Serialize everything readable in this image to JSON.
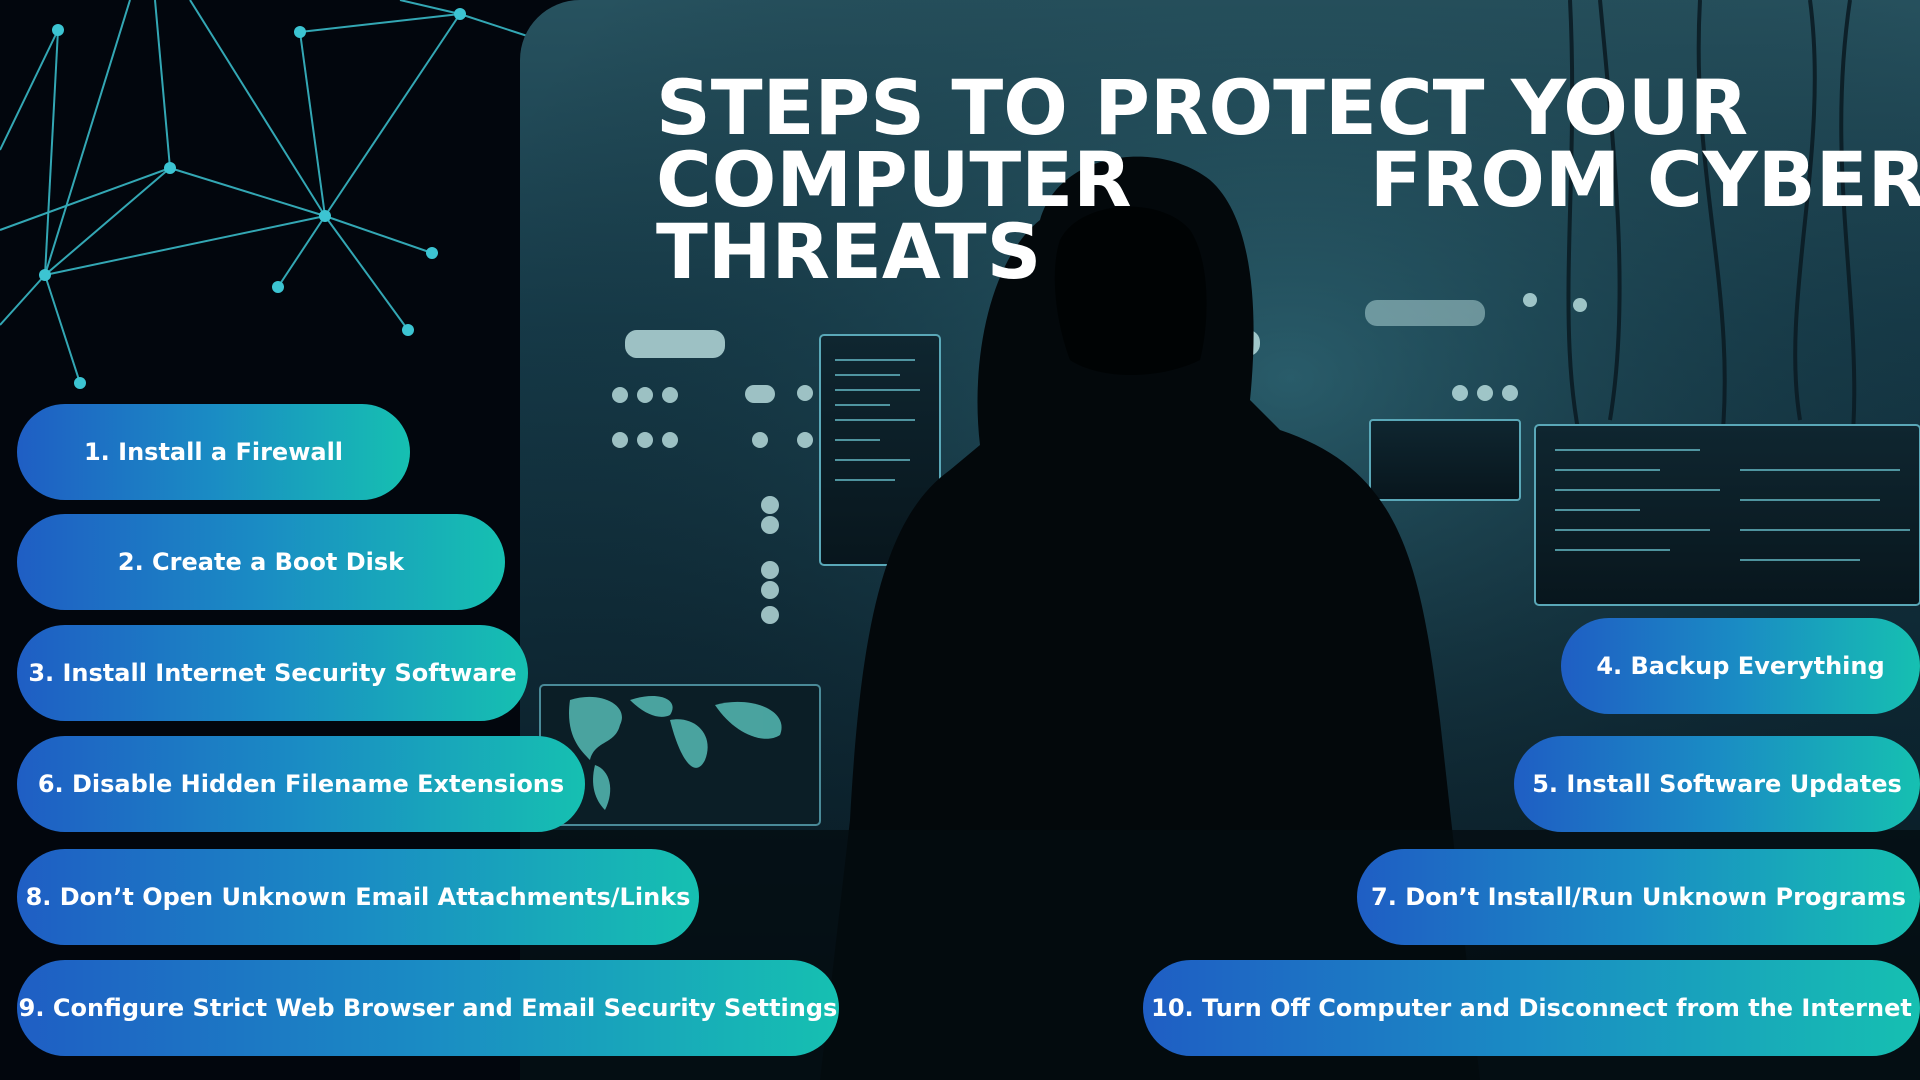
{
  "title": {
    "line1": "STEPS TO PROTECT YOUR",
    "line2": "COMPUTER         FROM CYBER",
    "line3": "THREATS"
  },
  "steps": {
    "s1": "1. Install a Firewall",
    "s2": "2. Create a Boot Disk",
    "s3": "3. Install Internet Security Software",
    "s4": "4. Backup Everything",
    "s5": "5. Install Software Updates",
    "s6": "6. Disable Hidden Filename Extensions",
    "s7": "7. Don’t Install/Run Unknown Programs",
    "s8": "8. Don’t Open Unknown Email Attachments/Links",
    "s9": "9. Configure Strict Web Browser and Email Security Settings",
    "s10": "10. Turn Off Computer and Disconnect from the Internet"
  },
  "colors": {
    "background": "#02060d",
    "pill_start": "#1f5ec4",
    "pill_end": "#16c0b1",
    "network": "#3cc4d2",
    "title": "#ffffff"
  }
}
